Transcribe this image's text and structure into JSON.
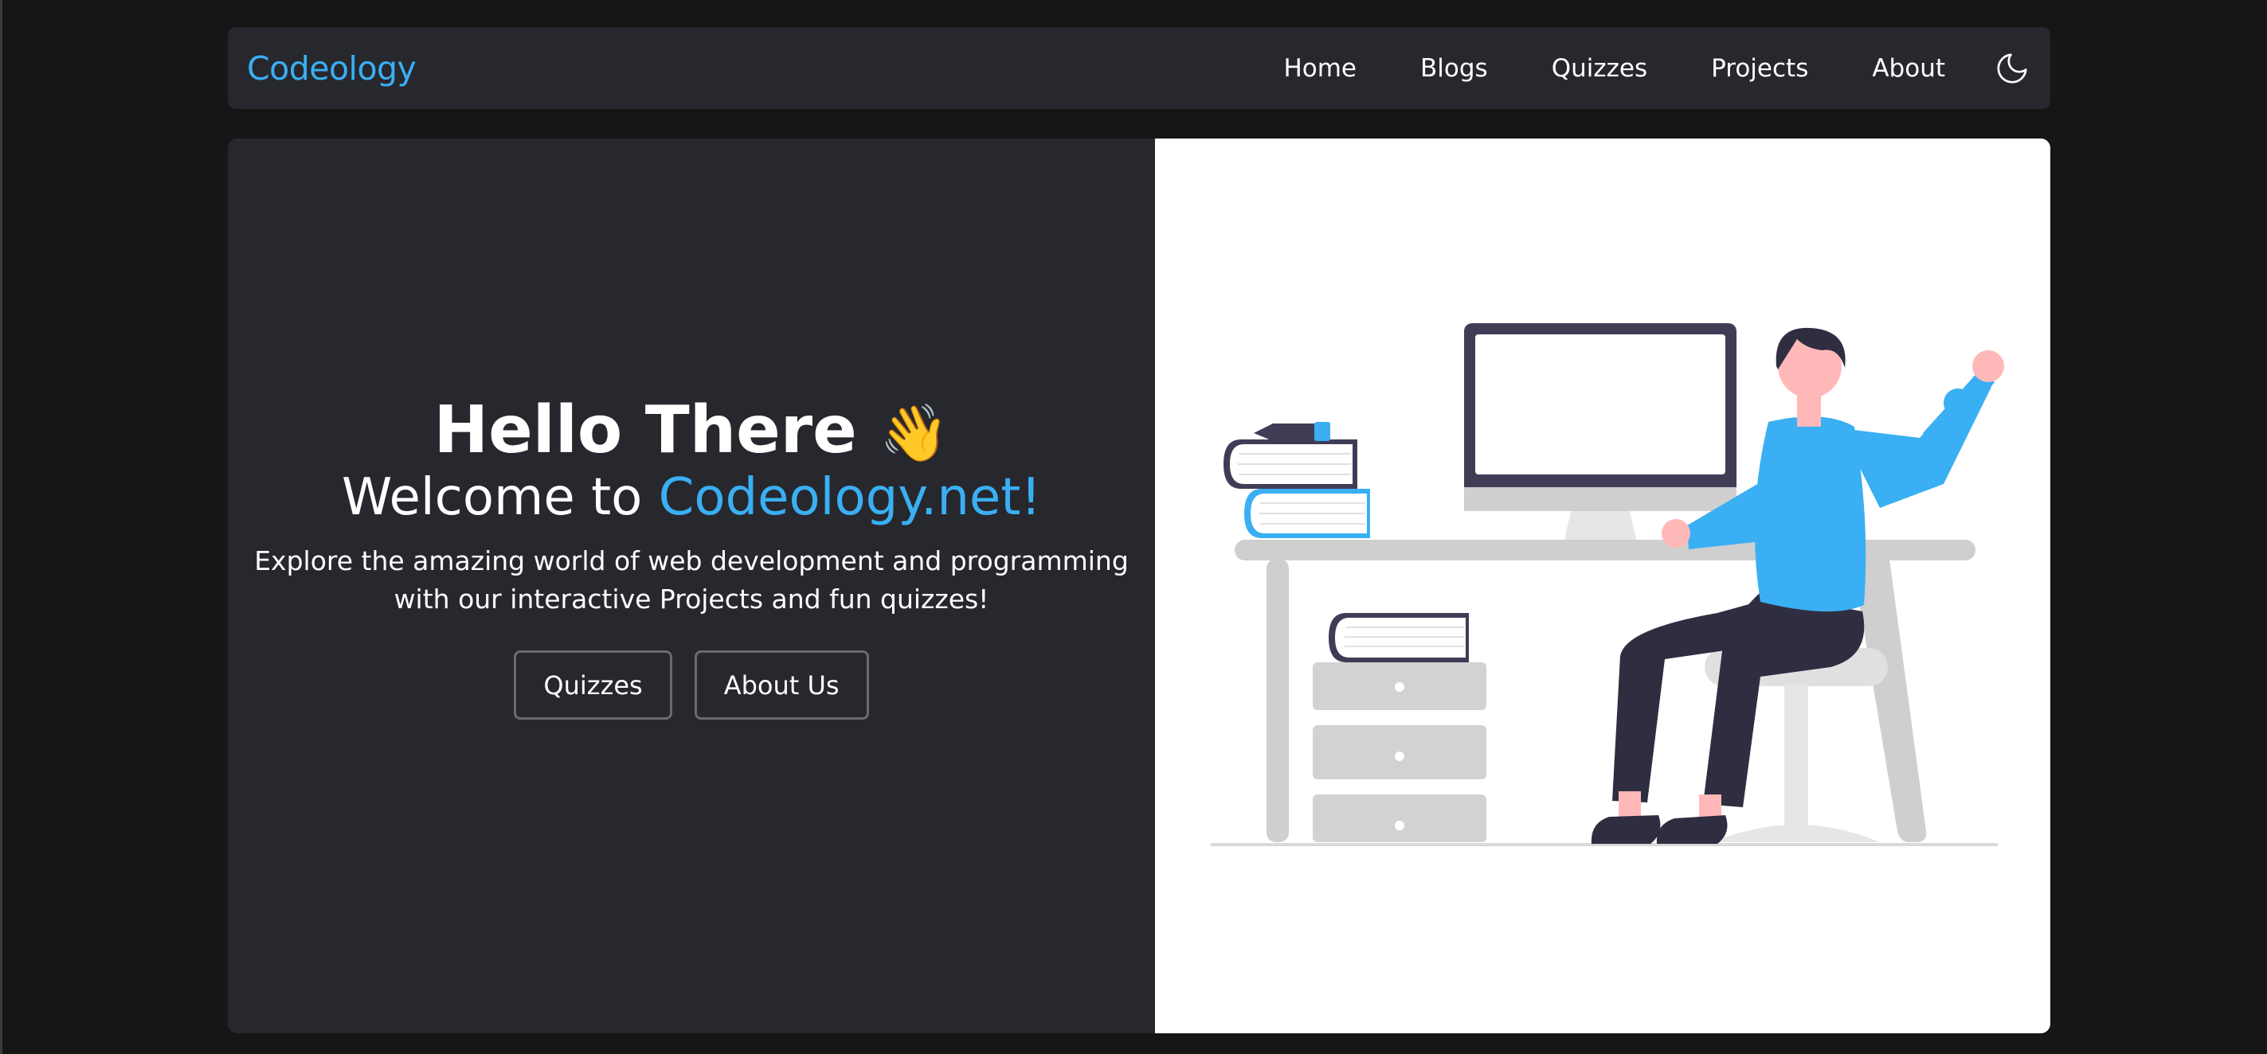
{
  "nav": {
    "brand": "Codeology",
    "links": [
      "Home",
      "Blogs",
      "Quizzes",
      "Projects",
      "About"
    ],
    "theme_icon": "moon-icon"
  },
  "hero": {
    "title": "Hello There",
    "wave_emoji": "👋",
    "welcome_prefix": "Welcome to ",
    "welcome_accent": "Codeology.net!",
    "description": "Explore the amazing world of web development and programming with our interactive Projects and fun quizzes!",
    "buttons": [
      "Quizzes",
      "About Us"
    ],
    "illustration": "person-at-desk-illustration"
  },
  "colors": {
    "background": "#161616",
    "panel": "#27282e",
    "accent": "#3aaff3",
    "illustration_bg": "#ffffff"
  }
}
